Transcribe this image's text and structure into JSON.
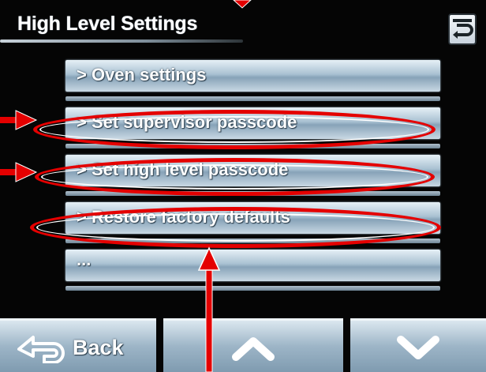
{
  "header": {
    "title": "High Level Settings",
    "return_icon": "return-arrow-icon"
  },
  "menu": {
    "items": [
      {
        "label": "> Oven settings"
      },
      {
        "label": "> Set supervisor passcode",
        "highlighted": true
      },
      {
        "label": "> Set high level passcode",
        "highlighted": true
      },
      {
        "label": "> Restore factory defaults",
        "highlighted": true
      },
      {
        "label": ""
      },
      {
        "label": "..."
      }
    ]
  },
  "bottom_nav": {
    "back_label": "Back",
    "back_icon": "back-arrow-icon",
    "up_icon": "chevron-up-icon",
    "down_icon": "chevron-down-icon"
  },
  "annotations": {
    "color": "#e40000",
    "shapes": [
      "ellipse",
      "arrow"
    ]
  },
  "colors": {
    "screen_background": "#050505",
    "button_light": "#dbe7ef",
    "button_dark": "#7f9bb0",
    "annotation_red": "#e40000"
  }
}
